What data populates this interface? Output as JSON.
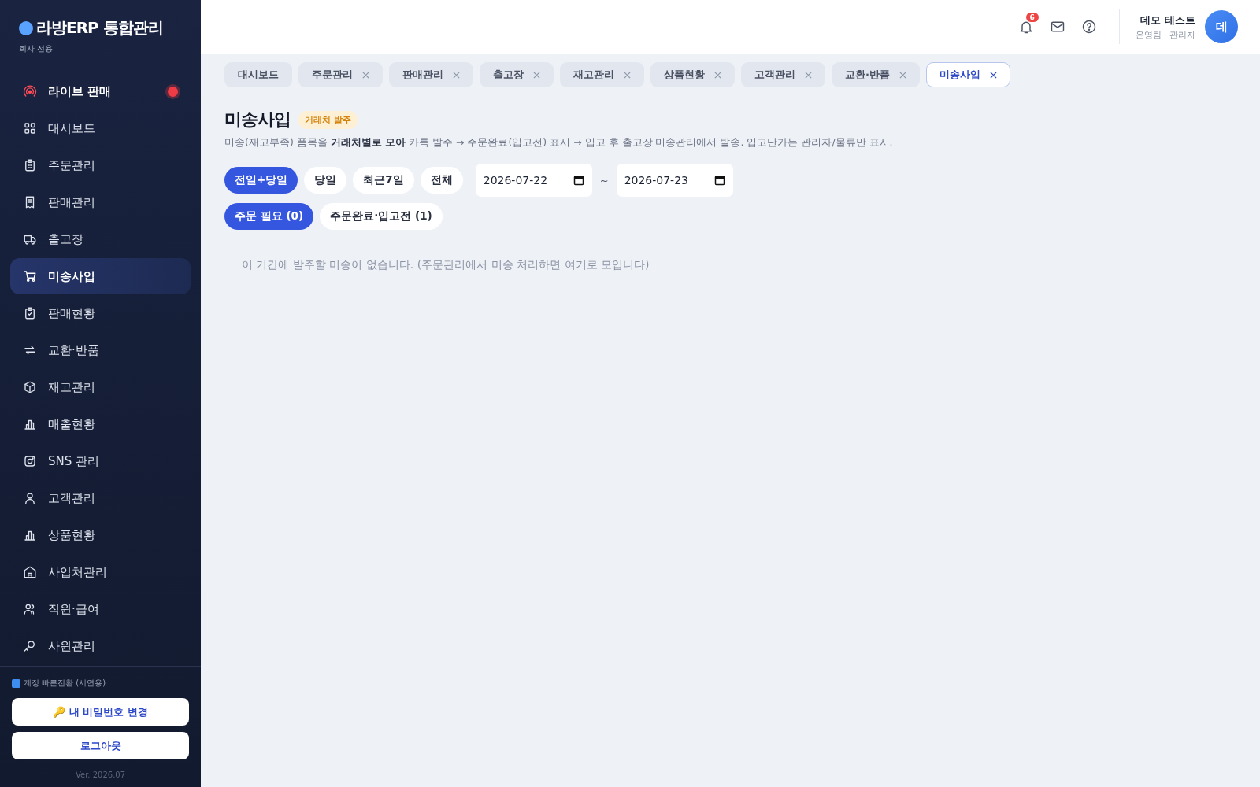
{
  "brand": {
    "title": "라방ERP 통합관리",
    "subtitle": "회사 전용"
  },
  "sidebar": {
    "items": [
      {
        "label": "라이브 판매",
        "selected": false,
        "kind": "live",
        "live": true
      },
      {
        "label": "대시보드",
        "selected": false
      },
      {
        "label": "주문관리",
        "selected": false
      },
      {
        "label": "판매관리",
        "selected": false
      },
      {
        "label": "출고장",
        "selected": false
      },
      {
        "label": "미송사입",
        "selected": true
      },
      {
        "label": "판매현황",
        "selected": false
      },
      {
        "label": "교환·반품",
        "selected": false
      },
      {
        "label": "재고관리",
        "selected": false
      },
      {
        "label": "매출현황",
        "selected": false
      },
      {
        "label": "SNS 관리",
        "selected": false
      },
      {
        "label": "고객관리",
        "selected": false
      },
      {
        "label": "상품현황",
        "selected": false
      },
      {
        "label": "사입처관리",
        "selected": false
      },
      {
        "label": "직원·급여",
        "selected": false
      },
      {
        "label": "사원관리",
        "selected": false
      }
    ],
    "quick_switch": "계정 빠른전환 (시연용)",
    "password_button": "🔑 내 비밀번호 변경",
    "logout_button": "로그아웃",
    "version": "Ver. 2026.07"
  },
  "header": {
    "notification_count": "6",
    "user_name": "데모 테스트",
    "user_role": "운영팀 · 관리자",
    "avatar": "데"
  },
  "tabs": [
    {
      "label": "대시보드",
      "selected": false,
      "closable": false
    },
    {
      "label": "주문관리",
      "selected": false,
      "closable": true
    },
    {
      "label": "판매관리",
      "selected": false,
      "closable": true
    },
    {
      "label": "출고장",
      "selected": false,
      "closable": true
    },
    {
      "label": "재고관리",
      "selected": false,
      "closable": true
    },
    {
      "label": "상품현황",
      "selected": false,
      "closable": true
    },
    {
      "label": "고객관리",
      "selected": false,
      "closable": true
    },
    {
      "label": "교환·반품",
      "selected": false,
      "closable": true
    },
    {
      "label": "미송사입",
      "selected": true,
      "closable": true
    }
  ],
  "page": {
    "title": "미송사입",
    "badge": "거래처 발주",
    "description": "미송(재고부족) 품목을 **거래처별로 모아** 카톡 발주 → 주문완료(입고전) 표시 → 입고 후 출고장 미송관리에서 발송. 입고단가는 관리자/물류만 표시.",
    "range_buttons": [
      {
        "label": "전일+당일",
        "selected": true
      },
      {
        "label": "당일",
        "selected": false
      },
      {
        "label": "최근7일",
        "selected": false
      },
      {
        "label": "전체",
        "selected": false
      }
    ],
    "date_from": "2026-07-22",
    "date_separator": "~",
    "date_to": "2026-07-23",
    "status_filters": [
      {
        "label": "주문 필요 (0)",
        "selected": true
      },
      {
        "label": "주문완료·입고전 (1)",
        "selected": false
      }
    ],
    "empty_message": "이 기간에 발주할 미송이 없습니다. (주문관리에서 미송 처리하면 여기로 모입니다)"
  }
}
